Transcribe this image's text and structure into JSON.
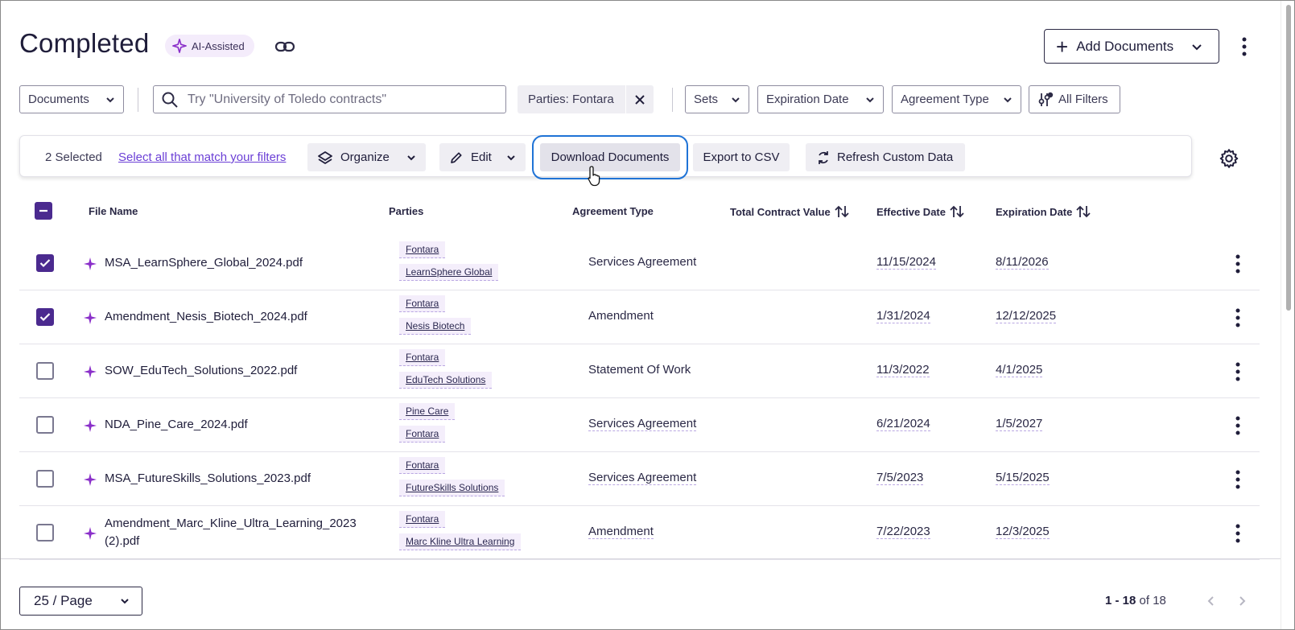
{
  "header": {
    "title": "Completed",
    "ai_badge": "AI-Assisted",
    "add_documents_label": "Add Documents"
  },
  "filters": {
    "view_select": "Documents",
    "search_placeholder": "Try \"University of Toledo contracts\"",
    "active_chip": "Parties: Fontara",
    "sets": "Sets",
    "expiration_date": "Expiration Date",
    "agreement_type": "Agreement Type",
    "all_filters": "All Filters"
  },
  "action_bar": {
    "selected_count": "2 Selected",
    "select_all_link": "Select all that match your filters",
    "organize": "Organize",
    "edit": "Edit",
    "download": "Download Documents",
    "export_csv": "Export to CSV",
    "refresh": "Refresh Custom Data"
  },
  "table": {
    "columns": [
      "File Name",
      "Parties",
      "Agreement Type",
      "Total Contract Value",
      "Effective Date",
      "Expiration Date"
    ],
    "rows": [
      {
        "checked": true,
        "file": "MSA_LearnSphere_Global_2024.pdf",
        "parties": [
          "Fontara",
          "LearnSphere Global"
        ],
        "agreement_type": "Services Agreement",
        "effective": "11/15/2024",
        "expiration": "8/11/2026"
      },
      {
        "checked": true,
        "file": "Amendment_Nesis_Biotech_2024.pdf",
        "parties": [
          "Fontara",
          "Nesis Biotech"
        ],
        "agreement_type": "Amendment",
        "effective": "1/31/2024",
        "expiration": "12/12/2025"
      },
      {
        "checked": false,
        "file": "SOW_EduTech_Solutions_2022.pdf",
        "parties": [
          "Fontara",
          "EduTech Solutions"
        ],
        "agreement_type": "Statement Of Work",
        "effective": "11/3/2022",
        "expiration": "4/1/2025"
      },
      {
        "checked": false,
        "file": "NDA_Pine_Care_2024.pdf",
        "parties": [
          "Pine Care",
          "Fontara"
        ],
        "agreement_type": "Services Agreement",
        "effective": "6/21/2024",
        "expiration": "1/5/2027"
      },
      {
        "checked": false,
        "file": "MSA_FutureSkills_Solutions_2023.pdf",
        "parties": [
          "Fontara",
          "FutureSkills Solutions"
        ],
        "agreement_type": "Services Agreement",
        "effective": "7/5/2023",
        "expiration": "5/15/2025"
      },
      {
        "checked": false,
        "file": "Amendment_Marc_Kline_Ultra_Learning_2023 (2).pdf",
        "parties": [
          "Fontara",
          "Marc Kline Ultra Learning"
        ],
        "agreement_type": "Amendment",
        "effective": "7/22/2023",
        "expiration": "12/3/2025"
      }
    ]
  },
  "footer": {
    "page_size": "25 / Page",
    "range_bold": "1 - 18",
    "range_rest": " of 18"
  },
  "colors": {
    "accent": "#4b2a8f",
    "highlight_outline": "#1f73d6",
    "link": "#6b3fd6"
  }
}
